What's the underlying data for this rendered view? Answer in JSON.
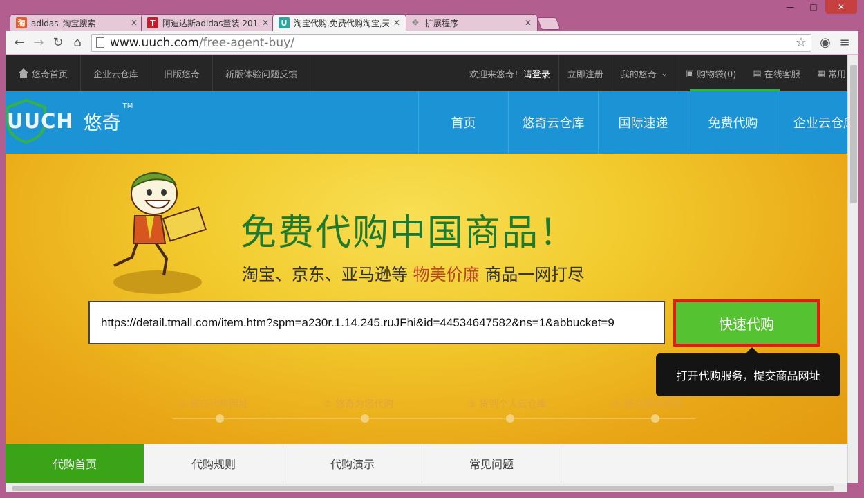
{
  "browser": {
    "tabs": [
      {
        "title": "adidas_淘宝搜索",
        "favicon": "淘",
        "favicon_color": "#e85f26",
        "active": false
      },
      {
        "title": "阿迪达斯adidas童装 201",
        "favicon": "T",
        "favicon_color": "#c71c2a",
        "active": false
      },
      {
        "title": "淘宝代购,免费代购淘宝,天",
        "favicon": "U",
        "favicon_color": "#2aa6a1",
        "active": true
      },
      {
        "title": "扩展程序",
        "favicon": "puzzle-icon",
        "favicon_color": "#888888",
        "active": false
      }
    ],
    "address": {
      "host": "www.uuch.com",
      "path": "/free-agent-buy/"
    }
  },
  "topbar": {
    "left": [
      "悠奇首页",
      "企业云仓库",
      "旧版悠奇",
      "新版体验问题反馈"
    ],
    "welcome": "欢迎来悠奇！",
    "login": "请登录",
    "register": "立即注册",
    "my": "我的悠奇",
    "cart": "购物袋(0)",
    "service": "在线客服",
    "common": "常用"
  },
  "header": {
    "logo_text": "UUCH",
    "logo_cn": "悠奇",
    "logo_tm": "TM",
    "nav": [
      "首页",
      "悠奇云仓库",
      "国际速递",
      "免费代购",
      "企业云仓库"
    ]
  },
  "hero": {
    "title": "免费代购中国商品！",
    "subtitle_pre": "淘宝、京东、亚马逊等",
    "subtitle_highlight": "物美价廉",
    "subtitle_post": "商品一网打尽",
    "url_value": "https://detail.tmall.com/item.htm?spm=a230r.1.14.245.ruJFhi&id=44534647582&ns=1&abbucket=9",
    "button": "快速代购",
    "tooltip": "打开代购服务，提交商品网址",
    "steps": [
      "① 提交代购网址",
      "② 悠奇为您代购",
      "③ 货到个人云仓库",
      "④ 提交国际快递"
    ]
  },
  "subtabs": [
    "代购首页",
    "代购规则",
    "代购演示",
    "常见问题"
  ]
}
